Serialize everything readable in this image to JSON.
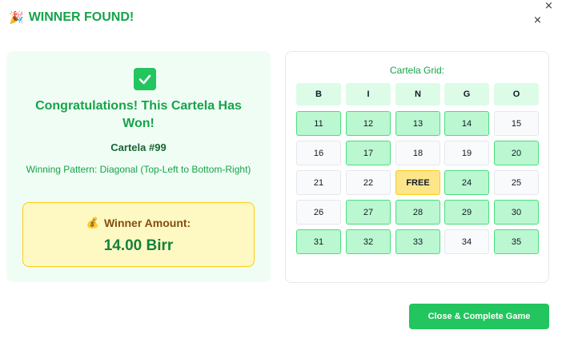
{
  "header": {
    "icon": "party-popper-icon",
    "title": "WINNER FOUND!",
    "close_glyph": "×"
  },
  "winner": {
    "check_icon": "check-mark-icon",
    "congrats": "Congratulations! This Cartela Has Won!",
    "cartela_label": "Cartela #99",
    "pattern": "Winning Pattern: Diagonal (Top-Left to Bottom-Right)",
    "amount_icon": "money-bag-icon",
    "amount_label": "Winner Amount:",
    "amount_value": "14.00 Birr"
  },
  "grid": {
    "title": "Cartela Grid:",
    "headers": [
      "B",
      "I",
      "N",
      "G",
      "O"
    ],
    "rows": [
      [
        {
          "v": "11",
          "s": "marked"
        },
        {
          "v": "12",
          "s": "marked"
        },
        {
          "v": "13",
          "s": "marked"
        },
        {
          "v": "14",
          "s": "marked"
        },
        {
          "v": "15",
          "s": "unmarked"
        }
      ],
      [
        {
          "v": "16",
          "s": "unmarked"
        },
        {
          "v": "17",
          "s": "marked"
        },
        {
          "v": "18",
          "s": "unmarked"
        },
        {
          "v": "19",
          "s": "unmarked"
        },
        {
          "v": "20",
          "s": "marked"
        }
      ],
      [
        {
          "v": "21",
          "s": "unmarked"
        },
        {
          "v": "22",
          "s": "unmarked"
        },
        {
          "v": "FREE",
          "s": "free"
        },
        {
          "v": "24",
          "s": "marked"
        },
        {
          "v": "25",
          "s": "unmarked"
        }
      ],
      [
        {
          "v": "26",
          "s": "unmarked"
        },
        {
          "v": "27",
          "s": "marked"
        },
        {
          "v": "28",
          "s": "marked"
        },
        {
          "v": "29",
          "s": "marked"
        },
        {
          "v": "30",
          "s": "marked"
        }
      ],
      [
        {
          "v": "31",
          "s": "marked"
        },
        {
          "v": "32",
          "s": "marked"
        },
        {
          "v": "33",
          "s": "marked"
        },
        {
          "v": "34",
          "s": "unmarked"
        },
        {
          "v": "35",
          "s": "marked"
        }
      ]
    ]
  },
  "footer": {
    "complete_label": "Close & Complete Game"
  },
  "colors": {
    "accent_green": "#16a34a",
    "marked_cell": "#bbf7d0",
    "free_cell": "#fde68a",
    "amount_bg": "#fef9c3"
  }
}
